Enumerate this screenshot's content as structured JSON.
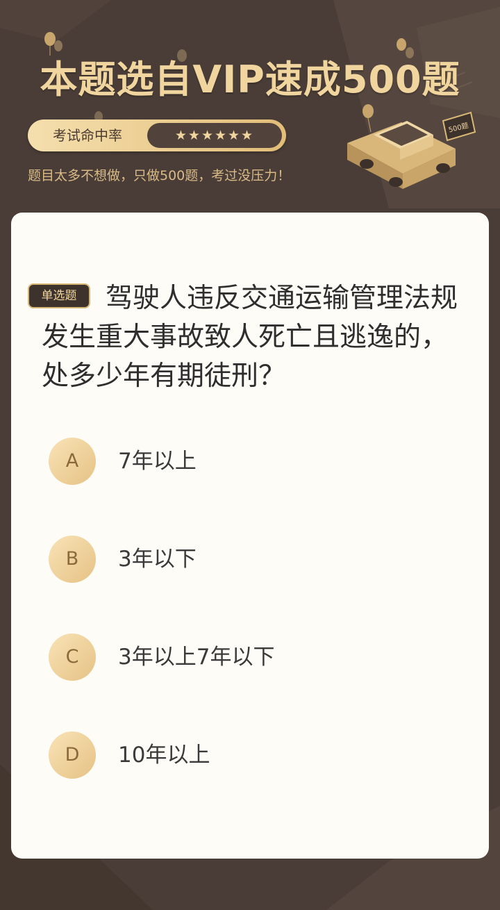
{
  "banner": {
    "title": "本题选自VIP速成500题",
    "rate_label": "考试命中率",
    "rate_stars": "★★★★★★",
    "slogan": "题目太多不想做，只做500题，考过没压力！",
    "car_badge": "500题"
  },
  "question": {
    "type_tag": "单选题",
    "text": "驾驶人违反交通运输管理法规发生重大事故致人死亡且逃逸的，处多少年有期徒刑？"
  },
  "options": [
    {
      "letter": "A",
      "text": "7年以上"
    },
    {
      "letter": "B",
      "text": "3年以下"
    },
    {
      "letter": "C",
      "text": "3年以上7年以下"
    },
    {
      "letter": "D",
      "text": "10年以上"
    }
  ],
  "colors": {
    "background": "#4a3d37",
    "accent_gold": "#f1d59f",
    "card": "#fdfcf7",
    "text": "#2e2e2e"
  }
}
